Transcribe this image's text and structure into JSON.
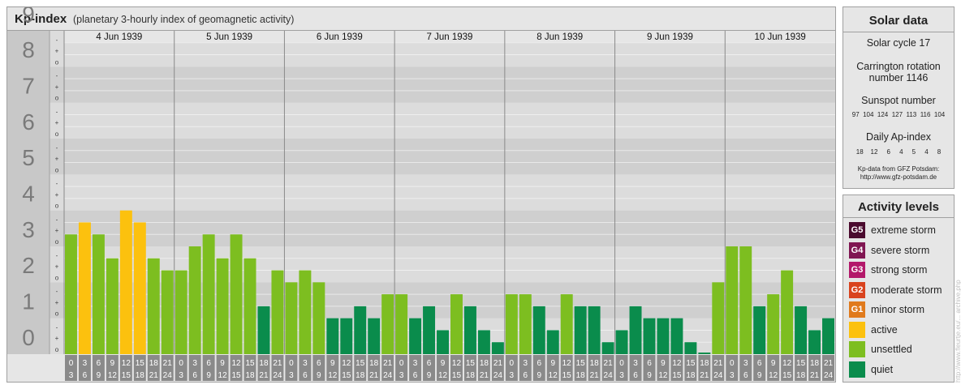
{
  "header": {
    "title": "Kp-index",
    "subtitle": "(planetary 3-hourly index of geomagnetic activity)"
  },
  "chart_data": {
    "type": "bar",
    "title": "Kp-index",
    "subtitle": "(planetary 3-hourly index of geomagnetic activity)",
    "ylim": [
      0,
      9
    ],
    "y_ticks": [
      "0",
      "1",
      "2",
      "3",
      "4",
      "5",
      "6",
      "7",
      "8",
      "9"
    ],
    "sub_ticks": [
      "o",
      "+",
      "-"
    ],
    "days": [
      "4 Jun 1939",
      "5 Jun 1939",
      "6 Jun 1939",
      "7 Jun 1939",
      "8 Jun 1939",
      "9 Jun 1939",
      "10 Jun 1939"
    ],
    "interval_top": [
      "0",
      "3",
      "6",
      "9",
      "12",
      "15",
      "18",
      "21"
    ],
    "interval_bottom": [
      "3",
      "6",
      "9",
      "12",
      "15",
      "18",
      "21",
      "24"
    ],
    "values": [
      [
        3.333,
        3.667,
        3.333,
        2.667,
        4.0,
        3.667,
        2.667,
        2.333
      ],
      [
        2.333,
        3.0,
        3.333,
        2.667,
        3.333,
        2.667,
        1.333,
        2.333
      ],
      [
        2.0,
        2.333,
        2.0,
        1.0,
        1.0,
        1.333,
        1.0,
        1.667
      ],
      [
        1.667,
        1.0,
        1.333,
        0.667,
        1.667,
        1.333,
        0.667,
        0.333
      ],
      [
        1.667,
        1.667,
        1.333,
        0.667,
        1.667,
        1.333,
        1.333,
        0.333
      ],
      [
        0.667,
        1.333,
        1.0,
        1.0,
        1.0,
        0.333,
        0.0,
        2.0
      ],
      [
        3.0,
        3.0,
        1.333,
        1.667,
        2.333,
        1.333,
        0.667,
        1.0
      ]
    ],
    "level_colors": {
      "quiet": "#0a8c4c",
      "unsettled": "#7dbe20",
      "active": "#fcc10e",
      "minor": "#e07a1c",
      "moderate": "#d9431e",
      "strong": "#b3186a",
      "severe": "#801652",
      "extreme": "#4a0a2e"
    }
  },
  "solar": {
    "title": "Solar data",
    "cycle": "Solar cycle 17",
    "rotation_line1": "Carrington rotation",
    "rotation_line2": "number 1146",
    "sunspot_title": "Sunspot number",
    "sunspot_values": "97  104  124  127  113  116  104",
    "ap_title": "Daily Ap-index",
    "ap_values": "18    12     6     4     5     4     8",
    "source_line1": "Kp-data from GFZ Potsdam:",
    "source_line2": "http://www.gfz-potsdam.de"
  },
  "activity": {
    "title": "Activity levels",
    "items": [
      {
        "code": "G5",
        "label": "extreme storm",
        "color": "#4a0a2e"
      },
      {
        "code": "G4",
        "label": "severe storm",
        "color": "#801652"
      },
      {
        "code": "G3",
        "label": "strong storm",
        "color": "#b3186a"
      },
      {
        "code": "G2",
        "label": "moderate storm",
        "color": "#d9431e"
      },
      {
        "code": "G1",
        "label": "minor storm",
        "color": "#e07a1c"
      },
      {
        "code": "",
        "label": "active",
        "color": "#fcc10e"
      },
      {
        "code": "",
        "label": "unsettled",
        "color": "#7dbe20"
      },
      {
        "code": "",
        "label": "quiet",
        "color": "#0a8c4c"
      }
    ]
  },
  "watermark": "http://www.fleurtje.eu/... archive.php"
}
